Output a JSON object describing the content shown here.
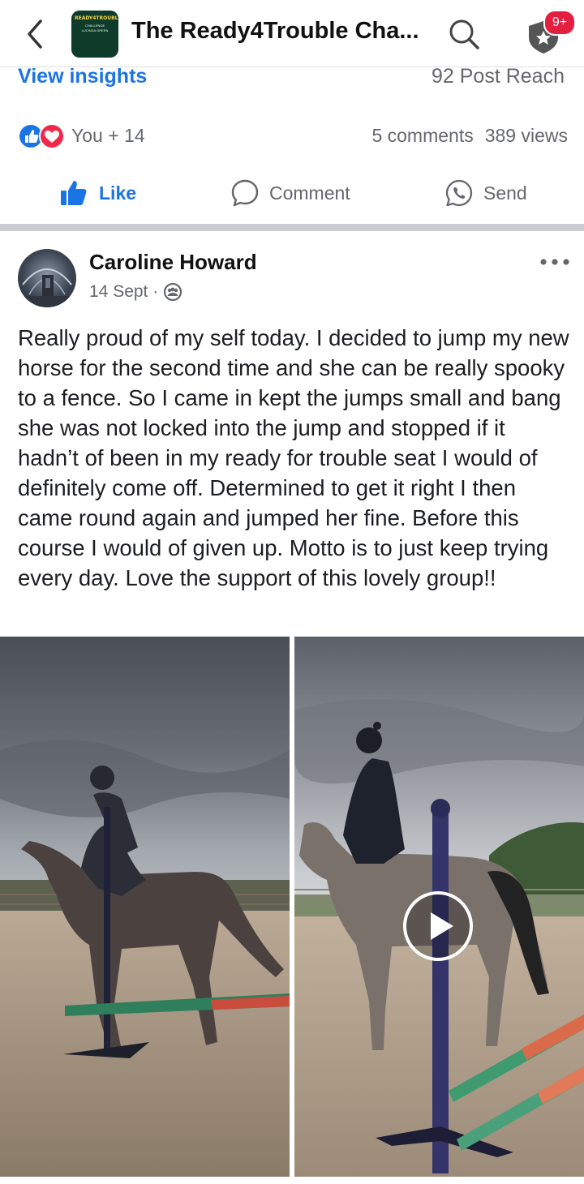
{
  "header": {
    "group_title": "The Ready4Trouble Cha...",
    "logo_text_line1": "READY4TROUBLE",
    "logo_text_line2": "CHALLENGE",
    "logo_text_line3": "LUCINDA GREEN",
    "notification_badge": "9+",
    "icons": [
      "chevron-left-icon",
      "search-icon",
      "shield-star-icon"
    ]
  },
  "insights": {
    "link_label": "View insights",
    "post_reach": "92 Post Reach"
  },
  "reactions": {
    "count_label": "You + 14",
    "comments": "5 comments",
    "views": "389 views",
    "icons": [
      "like-reaction-icon",
      "love-reaction-icon"
    ]
  },
  "actions": {
    "like": "Like",
    "comment": "Comment",
    "send": "Send"
  },
  "post": {
    "author": "Caroline Howard",
    "date": "14 Sept · ",
    "audience_icon": "group-audience-icon",
    "text": "Really proud of my self today. I decided to jump my new horse for the second time and she can be really spooky to a fence. So I came in kept the jumps small and bang she was not locked into the jump and stopped if it hadn’t of been in my ready for trouble seat I would of definitely come off. Determined to get it right I then came round again and jumped her fine. Before this course I would of given up. Motto is to just keep trying every day. Love the support of this lovely group!!"
  },
  "media": {
    "items": [
      {
        "kind": "photo",
        "subject": "rider on roan horse refusing a small jump in sand arena"
      },
      {
        "kind": "video",
        "subject": "rider on roan horse beside jump poles in sand arena"
      }
    ],
    "play_icon": "play-icon"
  },
  "colors": {
    "accent": "#1b74e4",
    "badge": "#e41e3f",
    "secondary_text": "#65676b",
    "divider": "#c9ccd1"
  }
}
